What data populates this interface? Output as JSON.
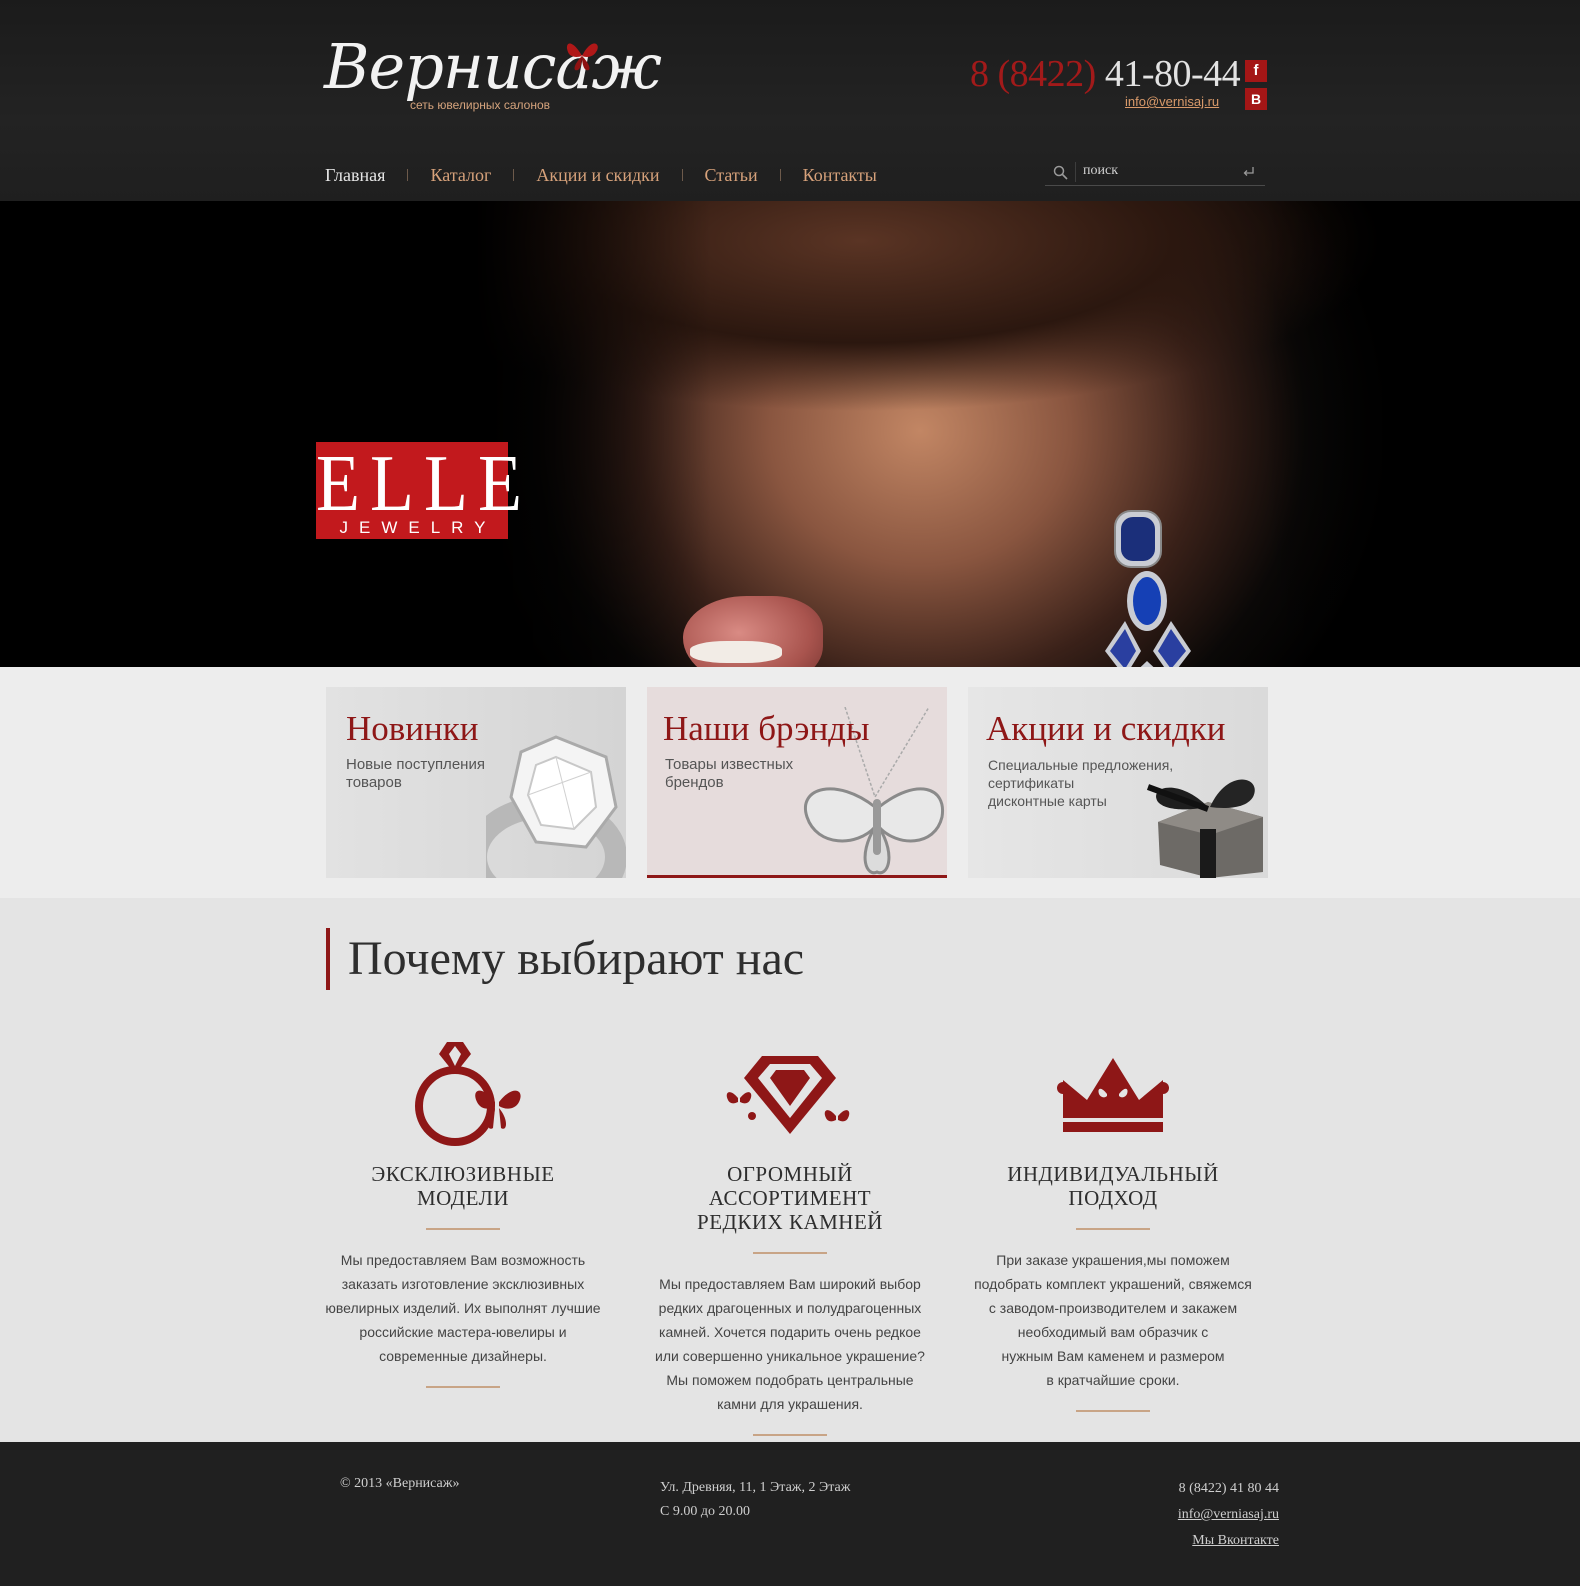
{
  "header": {
    "logo_text": "Вернисаж",
    "logo_sub": "сеть ювелирных салонов",
    "phone_code": "8 (8422)",
    "phone_number": "41-80-44",
    "email": "info@vernisaj.ru",
    "social": {
      "facebook": "f",
      "vk": "В"
    }
  },
  "nav": {
    "items": [
      {
        "label": "Главная"
      },
      {
        "label": "Каталог"
      },
      {
        "label": "Акции и скидки"
      },
      {
        "label": "Статьи"
      },
      {
        "label": "Контакты"
      }
    ]
  },
  "search": {
    "placeholder": "поиск"
  },
  "hero": {
    "brand_main": "ELLE",
    "brand_sub": "JEWELRY"
  },
  "promo": [
    {
      "title": "Новинки",
      "desc_1": "Новые поступления",
      "desc_2": "товаров",
      "desc_3": ""
    },
    {
      "title": "Наши брэнды",
      "desc_1": "Товары известных",
      "desc_2": "брендов",
      "desc_3": ""
    },
    {
      "title": "Акции и скидки",
      "desc_1": "Специальные предложения,",
      "desc_2": "сертификаты",
      "desc_3": "дисконтные карты"
    }
  ],
  "why": {
    "title": "Почему выбирают нас",
    "features": [
      {
        "title_1": "ЭКСКЛЮЗИВНЫЕ",
        "title_2": "МОДЕЛИ",
        "lines": [
          "Мы предоставляем Вам возможность",
          "заказать изготовление эксклюзивных",
          "ювелирных изделий. Их выполнят лучшие",
          "российские мастера-ювелиры и",
          "современные дизайнеры."
        ]
      },
      {
        "title_1": "ОГРОМНЫЙ АССОРТИМЕНТ",
        "title_2": "РЕДКИХ КАМНЕЙ",
        "lines": [
          "Мы предоставляем Вам широкий выбор",
          "редких драгоценных и полудрагоценных",
          "камней. Хочется подарить очень редкое",
          "или совершенно уникальное украшение?",
          "Мы поможем подобрать центральные",
          "камни для украшения."
        ]
      },
      {
        "title_1": "ИНДИВИДУАЛЬНЫЙ",
        "title_2": "ПОДХОД",
        "lines": [
          "При заказе украшения,мы поможем",
          "подобрать комплект украшений, свяжемся",
          "с заводом-производителем и закажем",
          "необходимый вам образчик с",
          "нужным Вам каменем и размером",
          "в кратчайшие сроки."
        ]
      }
    ]
  },
  "footer": {
    "copyright": "© 2013  «Вернисаж»",
    "address": "Ул. Древняя, 11, 1 Этаж, 2 Этаж",
    "hours": "С 9.00 до 20.00",
    "phone": "8 (8422) 41 80 44",
    "email": "info@verniasaj.ru",
    "vk_link": "Мы Вконтакте"
  },
  "colors": {
    "accent": "#8e1717",
    "nav_link": "#d6a17a",
    "header_bg": "#1f1f1f",
    "footer_bg": "#202020",
    "brand_red": "#c2191d"
  }
}
